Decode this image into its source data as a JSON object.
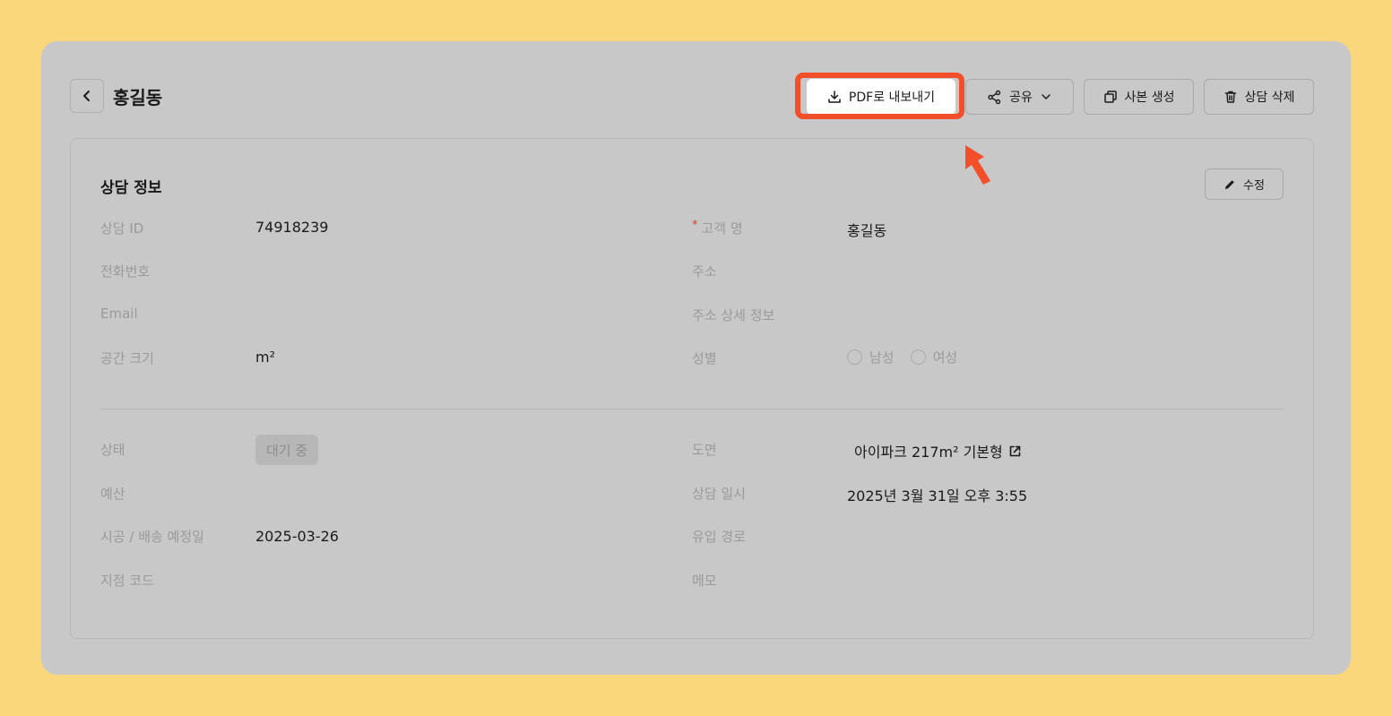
{
  "header": {
    "title": "홍길동",
    "buttons": {
      "pdf": "PDF로 내보내기",
      "share": "공유",
      "copy": "사본 생성",
      "delete": "상담 삭제"
    }
  },
  "section": {
    "title": "상담 정보",
    "edit": "수정"
  },
  "fields": {
    "consult_id": {
      "label": "상담 ID",
      "value": "74918239"
    },
    "customer_name": {
      "label": "고객 명",
      "required_mark": "*",
      "value": "홍길동"
    },
    "phone": {
      "label": "전화번호",
      "value": ""
    },
    "address": {
      "label": "주소",
      "value": ""
    },
    "email": {
      "label": "Email",
      "value": ""
    },
    "address_detail": {
      "label": "주소 상세 정보",
      "value": ""
    },
    "space_size": {
      "label": "공간 크기",
      "value": "m²"
    },
    "gender": {
      "label": "성별",
      "options": [
        "남성",
        "여성"
      ]
    },
    "status": {
      "label": "상태",
      "value": "대기 중"
    },
    "floorplan": {
      "label": "도면",
      "value": "아이파크 217m² 기본형"
    },
    "budget": {
      "label": "예산",
      "value": ""
    },
    "consult_datetime": {
      "label": "상담 일시",
      "value": "2025년 3월 31일 오후 3:55"
    },
    "install_date": {
      "label": "시공 / 배송 예정일",
      "value": "2025-03-26"
    },
    "inflow_path": {
      "label": "유입 경로",
      "value": ""
    },
    "branch_code": {
      "label": "지점 코드",
      "value": ""
    },
    "memo": {
      "label": "메모",
      "value": ""
    }
  },
  "colors": {
    "background": "#f9d77a",
    "frame": "#c8c8c8",
    "highlight": "#f24e2a",
    "label": "#9a9a9a"
  }
}
